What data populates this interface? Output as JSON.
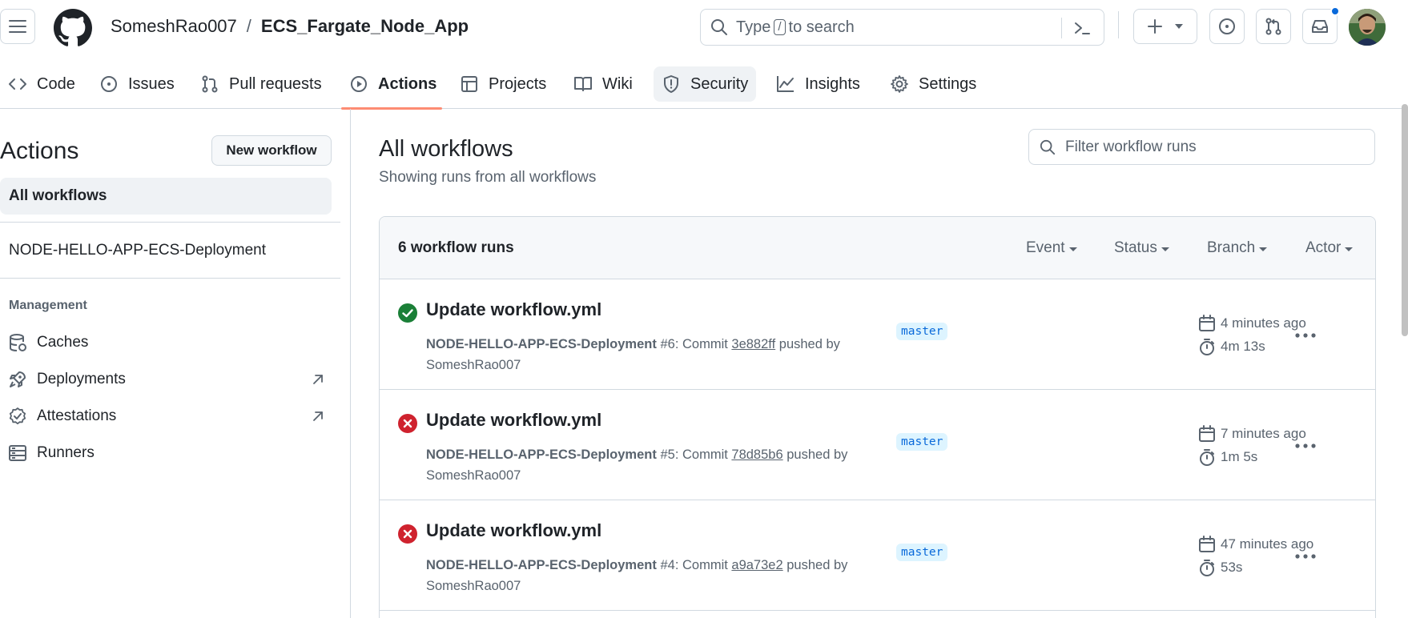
{
  "header": {
    "owner": "SomeshRao007",
    "separator": "/",
    "repo": "ECS_Fargate_Node_App",
    "search_before": "Type",
    "search_key": "/",
    "search_after": "to search"
  },
  "nav": {
    "code": "Code",
    "issues": "Issues",
    "pulls": "Pull requests",
    "actions": "Actions",
    "projects": "Projects",
    "wiki": "Wiki",
    "security": "Security",
    "insights": "Insights",
    "settings": "Settings"
  },
  "sidebar": {
    "title": "Actions",
    "new_workflow": "New workflow",
    "all_workflows": "All workflows",
    "workflow": "NODE-HELLO-APP-ECS-Deployment",
    "management_heading": "Management",
    "caches": "Caches",
    "deployments": "Deployments",
    "attestations": "Attestations",
    "runners": "Runners"
  },
  "main": {
    "title": "All workflows",
    "subtitle": "Showing runs from all workflows",
    "filter_placeholder": "Filter workflow runs",
    "runs_count": "6 workflow runs",
    "event": "Event",
    "status": "Status",
    "branch": "Branch",
    "actor": "Actor"
  },
  "runs": [
    {
      "status": "success",
      "title": "Update workflow.yml",
      "workflow": "NODE-HELLO-APP-ECS-Deployment",
      "number": "#6",
      "commit_label": ": Commit",
      "sha": "3e882ff",
      "pushed_by": "pushed by",
      "actor": "SomeshRao007",
      "branch": "master",
      "ago": "4 minutes ago",
      "duration": "4m 13s"
    },
    {
      "status": "failure",
      "title": "Update workflow.yml",
      "workflow": "NODE-HELLO-APP-ECS-Deployment",
      "number": "#5",
      "commit_label": ": Commit",
      "sha": "78d85b6",
      "pushed_by": "pushed by",
      "actor": "SomeshRao007",
      "branch": "master",
      "ago": "7 minutes ago",
      "duration": "1m 5s"
    },
    {
      "status": "failure",
      "title": "Update workflow.yml",
      "workflow": "NODE-HELLO-APP-ECS-Deployment",
      "number": "#4",
      "commit_label": ": Commit",
      "sha": "a9a73e2",
      "pushed_by": "pushed by",
      "actor": "SomeshRao007",
      "branch": "master",
      "ago": "47 minutes ago",
      "duration": "53s"
    }
  ],
  "colors": {
    "success": "#1a7f37",
    "failure": "#cf222e",
    "accent_underline": "#fd8c73",
    "notification_dot": "#0969da"
  }
}
